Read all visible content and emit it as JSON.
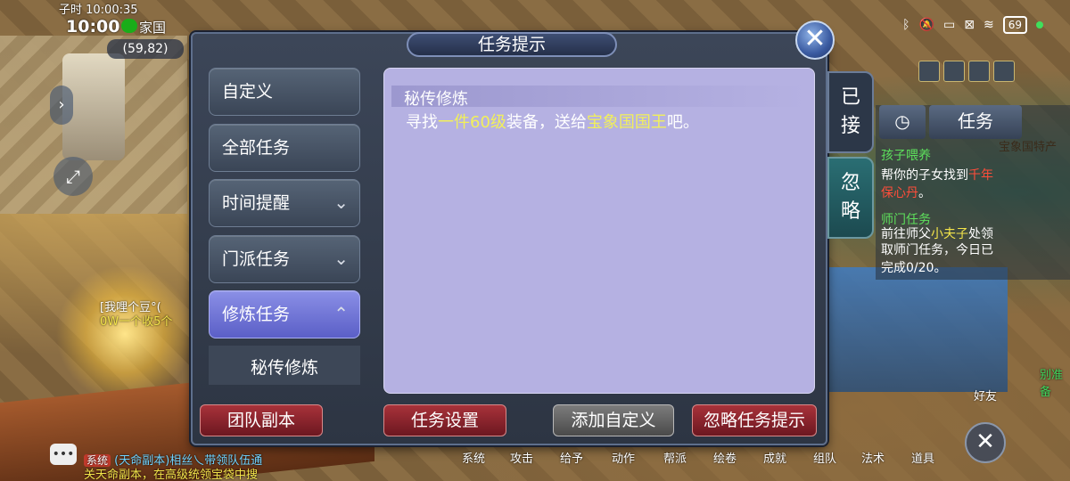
{
  "status_bar": {
    "time": "10:00",
    "wechat_tail": "家国",
    "battery": "69"
  },
  "hud": {
    "game_time": "子时 10:00:35",
    "coords": "(59,82)"
  },
  "dialog": {
    "title": "任务提示",
    "close_label": "✕",
    "sidebar": [
      {
        "label": "自定义",
        "chevron": ""
      },
      {
        "label": "全部任务",
        "chevron": ""
      },
      {
        "label": "时间提醒",
        "chevron": "⌄"
      },
      {
        "label": "门派任务",
        "chevron": "⌄"
      },
      {
        "label": "修炼任务",
        "chevron": "⌃"
      }
    ],
    "sub_item": "秘传修炼",
    "task": {
      "title": "秘传修炼",
      "desc_prefix": "寻找",
      "desc_item": "一件60级",
      "desc_mid": "装备，送给",
      "desc_npc": "宝象国国王",
      "desc_suffix": "吧。"
    },
    "tabs": {
      "accepted": [
        "已",
        "接"
      ],
      "ignored": [
        "忽",
        "略"
      ]
    },
    "buttons": {
      "team_dungeon": "团队副本",
      "task_settings": "任务设置",
      "add_custom": "添加自定义",
      "ignore_hint": "忽略任务提示"
    }
  },
  "right_hud": {
    "task_tab": "任务",
    "entries": [
      {
        "title": "孩子喂养",
        "text1": "帮你的子女找到",
        "hl1": "千年",
        "text2": "保心丹",
        "text3": "。"
      },
      {
        "title": "师门任务",
        "text1": "前往师父",
        "hl1": "小夫子",
        "text2": "处领",
        "text3": "取师门任务，今日已",
        "text4": "完成0/20。"
      }
    ],
    "bg_label": "宝象国特产"
  },
  "menu_bar": [
    "系统",
    "攻击",
    "给予",
    "动作",
    "帮派",
    "绘卷",
    "成就",
    "组队",
    "法术",
    "道具"
  ],
  "chat": {
    "tag": "系统",
    "line1": "(天命副本)相丝乀带领队伍通",
    "line2": "关天命副本，在高级统领宝袋中搜"
  },
  "scene_text": {
    "t1": "[我哩个豆°(",
    "t2": "0W一个收5个",
    "t3": "别准备",
    "friend": "好友"
  }
}
